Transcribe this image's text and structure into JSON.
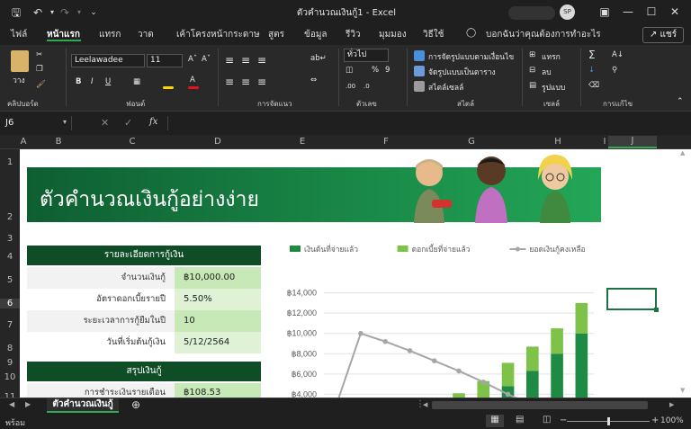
{
  "window": {
    "title": "ตัวคำนวณเงินกู้1  -  Excel",
    "avatar_initials": "SP"
  },
  "tabs": [
    {
      "label": "ไฟล์"
    },
    {
      "label": "หน้าแรก",
      "active": true
    },
    {
      "label": "แทรก"
    },
    {
      "label": "วาด"
    },
    {
      "label": "เค้าโครงหน้ากระดาษ"
    },
    {
      "label": "สูตร"
    },
    {
      "label": "ข้อมูล"
    },
    {
      "label": "รีวิว"
    },
    {
      "label": "มุมมอง"
    },
    {
      "label": "วิธีใช้"
    }
  ],
  "tell_me": "บอกฉันว่าคุณต้องการทำอะไร",
  "share_label": "แชร์",
  "ribbon": {
    "clipboard": {
      "paste": "วาง",
      "group": "คลิปบอร์ด"
    },
    "font": {
      "name": "Leelawadee",
      "size": "11",
      "group": "ฟอนต์"
    },
    "alignment": {
      "group": "การจัดแนว"
    },
    "number": {
      "format": "ทั่วไป",
      "group": "ตัวเลข"
    },
    "styles": {
      "conditional": "การจัดรูปแบบตามเงื่อนไข",
      "format_table": "จัดรูปแบบเป็นตาราง",
      "cell_styles": "สไตล์เซลล์",
      "group": "สไตล์"
    },
    "cells": {
      "insert": "แทรก",
      "delete": "ลบ",
      "format": "รูปแบบ",
      "group": "เซลล์"
    },
    "editing": {
      "group": "การแก้ไข"
    }
  },
  "formula_bar": {
    "name_box": "J6",
    "fx": "fx",
    "value": ""
  },
  "columns": [
    "A",
    "B",
    "C",
    "D",
    "E",
    "F",
    "G",
    "H",
    "I",
    "J"
  ],
  "rows": [
    "1",
    "2",
    "3",
    "4",
    "5",
    "6",
    "7",
    "8",
    "9",
    "10",
    "11"
  ],
  "banner_title": "ตัวคำนวณเงินกู้อย่างง่าย",
  "loan_details": {
    "header": "รายละเอียดการกู้เงิน",
    "items": [
      {
        "label": "จำนวนเงินกู้",
        "value": "฿10,000.00"
      },
      {
        "label": "อัตราดอกเบี้ยรายปี",
        "value": "5.50%"
      },
      {
        "label": "ระยะเวลาการกู้ยืมในปี",
        "value": "10"
      },
      {
        "label": "วันที่เริ่มต้นกู้เงิน",
        "value": "5/12/2564"
      }
    ]
  },
  "loan_summary": {
    "header": "สรุปเงินกู้",
    "items": [
      {
        "label": "การชำระเงินรายเดือน",
        "value": "฿108.53"
      }
    ]
  },
  "chart_data": {
    "type": "bar",
    "title": "",
    "legend_position": "top",
    "series": [
      {
        "name": "เงินต้นที่จ่ายแล้ว",
        "color": "#1e8a44",
        "values": [
          0,
          0,
          150,
          800,
          1300,
          2200,
          3200,
          4800,
          6300,
          8000,
          10000
        ]
      },
      {
        "name": "ดอกเบี้ยที่จ่ายแล้ว",
        "color": "#7ec24a",
        "values": [
          0,
          0,
          100,
          900,
          1400,
          1900,
          2100,
          2300,
          2400,
          2500,
          3000
        ]
      },
      {
        "name": "ยอดเงินกู้คงเหลือ",
        "color": "#a6a6a6",
        "type": "line",
        "values": [
          0,
          10000,
          9200,
          8300,
          7300,
          6300,
          5200,
          4000,
          2700,
          null,
          null
        ]
      }
    ],
    "y_ticks": [
      "฿14,000",
      "฿12,000",
      "฿10,000",
      "฿8,000",
      "฿6,000",
      "฿4,000"
    ],
    "ylim": [
      3500,
      14500
    ]
  },
  "sheet_tab": "ตัวคำนวณเงินกู้",
  "status": {
    "ready": "พร้อม",
    "zoom": "100%"
  }
}
